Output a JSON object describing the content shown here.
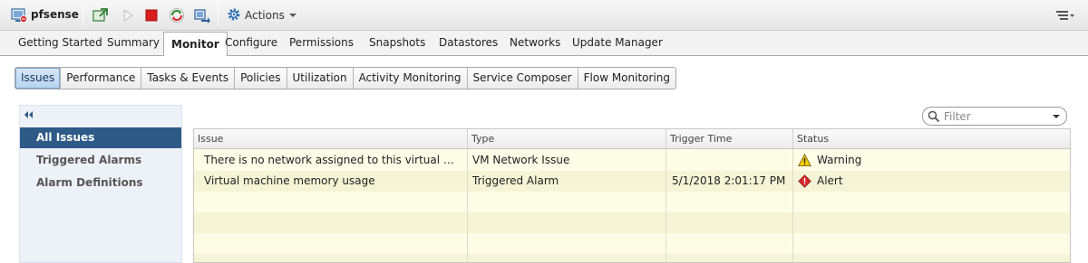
{
  "toolbar": {
    "vm_name": "pfsense",
    "actions_label": "Actions",
    "icons": [
      "vm-icon",
      "power-on-icon",
      "play-icon",
      "stop-icon",
      "restart-icon",
      "migrate-icon",
      "gear-icon",
      "menu-icon"
    ]
  },
  "main_tabs": [
    "Getting Started",
    "Summary",
    "Monitor",
    "Configure",
    "Permissions",
    "Snapshots",
    "Datastores",
    "Networks",
    "Update Manager"
  ],
  "active_main_tab": "Monitor",
  "sub_tabs": [
    "Issues",
    "Performance",
    "Tasks & Events",
    "Policies",
    "Utilization",
    "Activity Monitoring",
    "Service Composer",
    "Flow Monitoring"
  ],
  "active_sub_tab": "Issues",
  "left_nav": [
    "All Issues",
    "Triggered Alarms",
    "Alarm Definitions"
  ],
  "active_nav": "All Issues",
  "filter": {
    "placeholder": "Filter"
  },
  "table": {
    "columns": [
      "Issue",
      "Type",
      "Trigger Time",
      "Status"
    ],
    "rows": [
      {
        "issue": "There is no network assigned to this virtual machi...",
        "type": "VM Network Issue",
        "trigger_time": "",
        "status": "Warning",
        "status_icon": "warning-icon"
      },
      {
        "issue": "Virtual machine memory usage",
        "type": "Triggered Alarm",
        "trigger_time": "5/1/2018 2:01:17 PM",
        "status": "Alert",
        "status_icon": "alert-icon"
      }
    ]
  },
  "colors": {
    "accent": "#2e5a87",
    "row_bg": "#fdfce6",
    "warning": "#f4d000",
    "alert": "#d9262b"
  }
}
